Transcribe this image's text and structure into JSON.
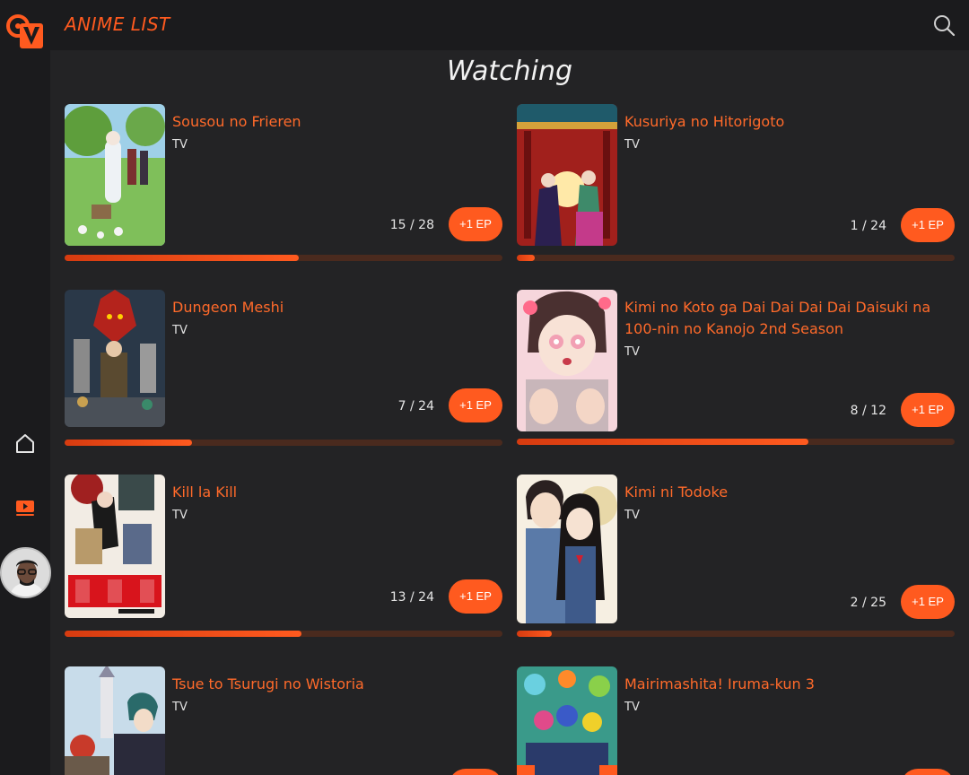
{
  "header": {
    "app_title": "ANIME LIST",
    "section_title": "Watching"
  },
  "icons": {
    "logo": "logo-icon",
    "search": "search-icon",
    "home": "home-icon",
    "watching": "tv-play-icon",
    "avatar": "user-avatar"
  },
  "colors": {
    "accent": "#ff5a1f",
    "background": "#232325",
    "sidebar": "#1b1b1d"
  },
  "cards": [
    {
      "title": "Sousou no Frieren",
      "type": "TV",
      "progress": "15 / 28",
      "watched": 15,
      "total": 28,
      "button": "+1 EP"
    },
    {
      "title": "Kusuriya no Hitorigoto",
      "type": "TV",
      "progress": "1 / 24",
      "watched": 1,
      "total": 24,
      "button": "+1 EP"
    },
    {
      "title": "Dungeon Meshi",
      "type": "TV",
      "progress": "7 / 24",
      "watched": 7,
      "total": 24,
      "button": "+1 EP"
    },
    {
      "title": "Kimi no Koto ga Dai Dai Dai Dai Daisuki na 100-nin no Kanojo 2nd Season",
      "type": "TV",
      "progress": "8 / 12",
      "watched": 8,
      "total": 12,
      "button": "+1 EP"
    },
    {
      "title": "Kill la Kill",
      "type": "TV",
      "progress": "13 / 24",
      "watched": 13,
      "total": 24,
      "button": "+1 EP"
    },
    {
      "title": "Kimi ni Todoke",
      "type": "TV",
      "progress": "2 / 25",
      "watched": 2,
      "total": 25,
      "button": "+1 EP"
    },
    {
      "title": "Tsue to Tsurugi no Wistoria",
      "type": "TV",
      "progress": "",
      "watched": 0,
      "total": 0,
      "button": ""
    },
    {
      "title": "Mairimashita! Iruma-kun 3",
      "type": "TV",
      "progress": "",
      "watched": 0,
      "total": 0,
      "button": ""
    }
  ]
}
